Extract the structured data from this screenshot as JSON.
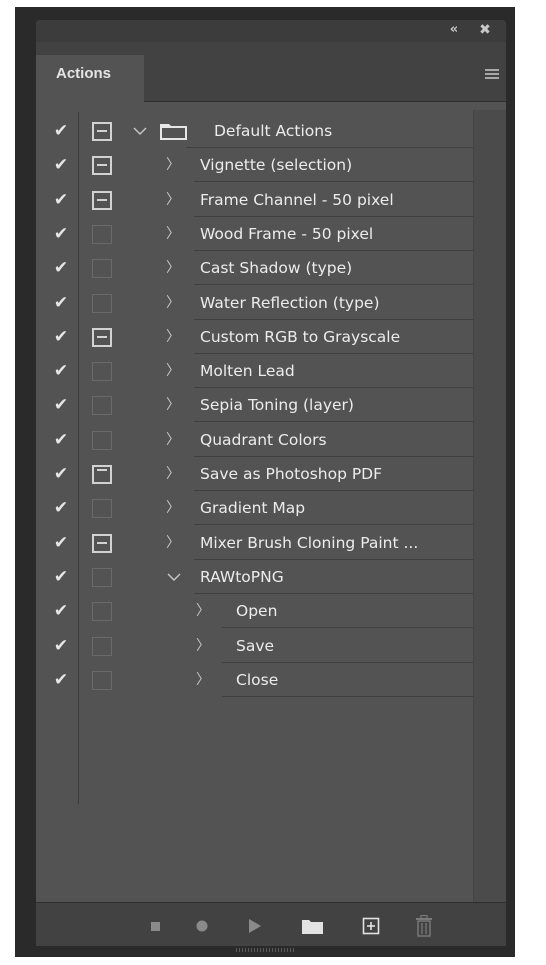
{
  "panel": {
    "tab_label": "Actions",
    "collapse_glyph": "«",
    "close_glyph": "✖",
    "menu_icon": "panel-menu-icon"
  },
  "rows": [
    {
      "type": "set",
      "label": "Default Actions",
      "checked": true,
      "dialog": true,
      "expanded": true
    },
    {
      "type": "action",
      "label": "Vignette (selection)",
      "checked": true,
      "dialog": true
    },
    {
      "type": "action",
      "label": "Frame Channel - 50 pixel",
      "checked": true,
      "dialog": true
    },
    {
      "type": "action",
      "label": "Wood Frame - 50 pixel",
      "checked": true,
      "dialog": false
    },
    {
      "type": "action",
      "label": "Cast Shadow (type)",
      "checked": true,
      "dialog": false
    },
    {
      "type": "action",
      "label": "Water Reflection (type)",
      "checked": true,
      "dialog": false
    },
    {
      "type": "action",
      "label": "Custom RGB to Grayscale",
      "checked": true,
      "dialog": true
    },
    {
      "type": "action",
      "label": "Molten Lead",
      "checked": true,
      "dialog": false
    },
    {
      "type": "action",
      "label": "Sepia Toning (layer)",
      "checked": true,
      "dialog": false
    },
    {
      "type": "action",
      "label": "Quadrant Colors",
      "checked": true,
      "dialog": false
    },
    {
      "type": "action",
      "label": "Save as Photoshop PDF",
      "checked": true,
      "dialog": true,
      "dialog_style": "top"
    },
    {
      "type": "action",
      "label": "Gradient Map",
      "checked": true,
      "dialog": false
    },
    {
      "type": "action",
      "label": "Mixer Brush Cloning Paint ...",
      "checked": true,
      "dialog": true
    },
    {
      "type": "action",
      "label": "RAWtoPNG",
      "checked": true,
      "dialog": false,
      "expanded": true
    },
    {
      "type": "step",
      "label": "Open",
      "checked": true,
      "dialog": false
    },
    {
      "type": "step",
      "label": "Save",
      "checked": true,
      "dialog": false
    },
    {
      "type": "step",
      "label": "Close",
      "checked": true,
      "dialog": false
    }
  ],
  "footer": {
    "buttons": [
      "stop-icon",
      "record-icon",
      "play-icon",
      "new-set-icon",
      "new-action-icon",
      "delete-icon"
    ]
  },
  "colors": {
    "panel_bg": "#535353",
    "header_bg": "#424242",
    "text": "#ececec",
    "icon": "#c8c8c8"
  }
}
